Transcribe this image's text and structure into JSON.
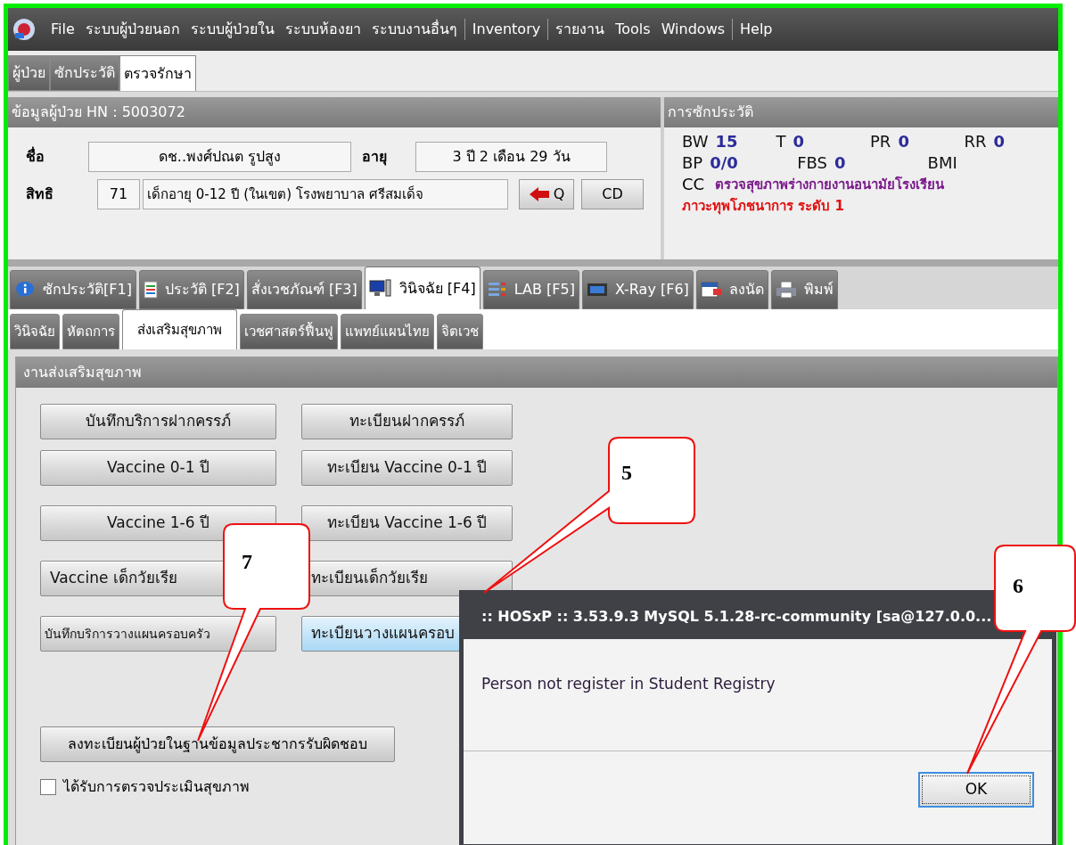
{
  "menu_groups": [
    [
      {
        "label": "File"
      },
      {
        "label": "ระบบผู้ป่วยนอก"
      },
      {
        "label": "ระบบผู้ป่วยใน"
      },
      {
        "label": "ระบบห้องยา"
      },
      {
        "label": "ระบบงานอื่นๆ"
      }
    ],
    [
      {
        "label": "Inventory"
      }
    ],
    [
      {
        "label": "รายงาน"
      },
      {
        "label": "Tools"
      },
      {
        "label": "Windows"
      }
    ],
    [
      {
        "label": "Help"
      }
    ]
  ],
  "top_tabs": [
    {
      "label": "ผู้ป่วย",
      "selected": false
    },
    {
      "label": "ซักประวัติ",
      "selected": false
    },
    {
      "label": "ตรวจรักษา",
      "selected": true
    }
  ],
  "patient": {
    "title": "ข้อมูลผู้ป่วย HN : 5003072",
    "name_label": "ชื่อ",
    "name": "ดช..พงศ์ปณต  รูปสูง",
    "age_label": "อายุ",
    "age": "3 ปี 2 เดือน 29 วัน",
    "right_label": "สิทธิ",
    "right_code": "71",
    "right_name": "เด็กอายุ 0-12 ปี (ในเขต) โรงพยาบาล ศรีสมเด็จ",
    "q_button": "Q",
    "cd_button": "CD"
  },
  "history": {
    "title": "การซักประวัติ",
    "vitals": [
      [
        {
          "label": "BW",
          "value": "15"
        },
        {
          "label": "T",
          "value": "0"
        },
        {
          "label": "PR",
          "value": "0"
        },
        {
          "label": "RR",
          "value": "0"
        }
      ],
      [
        {
          "label": "BP",
          "value": "0/0"
        },
        {
          "label": "FBS",
          "value": "0"
        },
        {
          "label": "BMI"
        }
      ]
    ],
    "cc_label": "CC",
    "cc": "ตรวจสุขภาพร่างกายงานอนามัยโรงเรียน",
    "note": "ภาวะทุพโภชนาการ ระดับ 1"
  },
  "main_tabs": [
    {
      "label": "ซักประวัติ[F1]",
      "kind": "info",
      "selected": false
    },
    {
      "label": "ประวัติ [F2]",
      "kind": "document",
      "selected": false
    },
    {
      "label": "สั่งเวชภัณฑ์ [F3]",
      "kind": "plain",
      "selected": false
    },
    {
      "label": "วินิจฉัย [F4]",
      "kind": "computer",
      "selected": true
    },
    {
      "label": "LAB [F5]",
      "kind": "list",
      "selected": false
    },
    {
      "label": "X-Ray [F6]",
      "kind": "film",
      "selected": false
    },
    {
      "label": "ลงนัด",
      "kind": "calendar",
      "selected": false
    },
    {
      "label": "พิมพ์",
      "kind": "printer",
      "selected": false
    }
  ],
  "sub_tabs": [
    {
      "label": "วินิจฉัย",
      "selected": false
    },
    {
      "label": "หัตถการ",
      "selected": false
    },
    {
      "label": "ส่งเสริมสุขภาพ",
      "selected": true
    },
    {
      "label": "เวชศาสตร์ฟื้นฟู",
      "selected": false
    },
    {
      "label": "แพทย์แผนไทย",
      "selected": false
    },
    {
      "label": "จิตเวช",
      "selected": false
    }
  ],
  "section": {
    "title": "งานส่งเสริมสุขภาพ",
    "button_rows": [
      [
        {
          "label": "บันทึกบริการฝากครรภ์",
          "highlighted": false
        },
        {
          "label": "ทะเบียนฝากครรภ์",
          "highlighted": false
        }
      ],
      [
        {
          "label": "Vaccine 0-1 ปี",
          "highlighted": false
        },
        {
          "label": "ทะเบียน Vaccine 0-1 ปี",
          "highlighted": false
        }
      ],
      [
        {
          "label": "Vaccine 1-6 ปี",
          "highlighted": false
        },
        {
          "label": "ทะเบียน Vaccine 1-6 ปี",
          "highlighted": false
        }
      ],
      [
        {
          "label": "Vaccine เด็กวัยเรีย",
          "highlighted": false
        },
        {
          "label": "ทะเบียนเด็กวัยเรีย",
          "highlighted": false
        }
      ],
      [
        {
          "label": "บันทึกบริการวางแผนครอบครัว",
          "highlighted": false
        },
        {
          "label": "ทะเบียนวางแผนครอบ",
          "highlighted": true
        }
      ]
    ],
    "register_button": "ลงทะเบียนผู้ป่วยในฐานข้อมูลประชากรรับผิดชอบ",
    "checkbox": {
      "label": "ได้รับการตรวจประเมินสุขภาพ",
      "checked": false
    }
  },
  "dialog": {
    "title": ":: HOSxP :: 3.53.9.3 MySQL 5.1.28-rc-community [sa@127.0.0...",
    "message": "Person not register in Student Registry",
    "ok": "OK"
  },
  "callouts": [
    {
      "number": "5"
    },
    {
      "number": "6"
    },
    {
      "number": "7"
    }
  ]
}
